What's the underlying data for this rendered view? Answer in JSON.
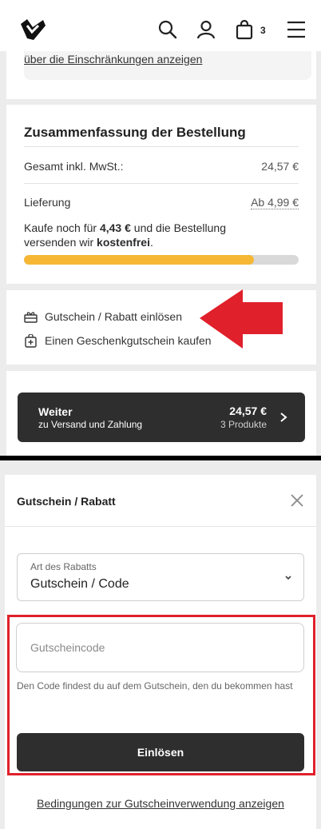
{
  "header": {
    "icons": [
      "logo-icon",
      "search-icon",
      "user-icon",
      "bag-icon",
      "menu-icon"
    ],
    "cart_count": "3"
  },
  "restrictions": {
    "link_text": "über die Einschränkungen anzeigen"
  },
  "summary": {
    "title": "Zusammenfassung der Bestellung",
    "total_label": "Gesamt inkl. MwSt.:",
    "total_value": "24,57 €",
    "delivery_label": "Lieferung",
    "delivery_value": "Ab 4,99 €",
    "free_prefix": "Kaufe noch für ",
    "free_amount": "4,43 €",
    "free_middle": " und die Bestellung versenden wir ",
    "free_word": "kostenfrei",
    "free_suffix": ".",
    "progress_fraction": 0.838,
    "progress_color": "#f6b735"
  },
  "vouchers": {
    "redeem_label": "Gutschein / Rabatt einlösen",
    "buy_label": "Einen Geschenkgutschein kaufen"
  },
  "checkout": {
    "title": "Weiter",
    "subtitle": "zu Versand und Zahlung",
    "price": "24,57 €",
    "count": "3 Produkte"
  },
  "modal": {
    "title": "Gutschein / Rabatt",
    "select_label": "Art des Rabatts",
    "select_value": "Gutschein / Code",
    "code_placeholder": "Gutscheincode",
    "hint": "Den Code findest du auf dem Gutschein, den du bekommen hast",
    "redeem_button": "Einlösen",
    "terms_link": "Bedingungen zur Gutscheinverwendung anzeigen"
  },
  "colors": {
    "annotation_red": "#e0202b",
    "button_dark": "#2e2e2e"
  }
}
